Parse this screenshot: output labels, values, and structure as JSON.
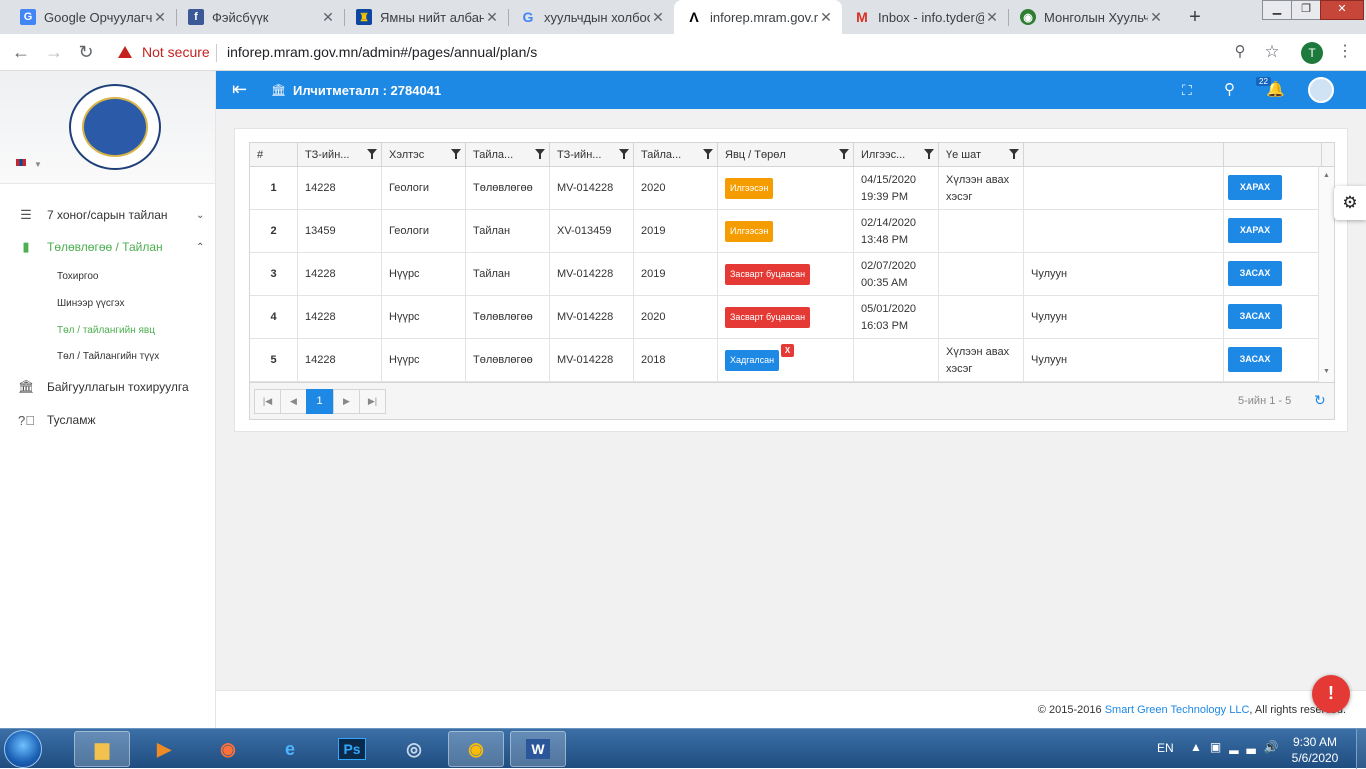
{
  "browser": {
    "tabs": [
      {
        "title": "Google Орчуулагч",
        "icon": "google-translate-icon",
        "icon_color": "#4285f4"
      },
      {
        "title": "Фэйсбүүк",
        "icon": "facebook-icon",
        "icon_color": "#3b5998"
      },
      {
        "title": "Ямны нийт албан",
        "icon": "soyombo-icon",
        "icon_color": "#c4272f"
      },
      {
        "title": "хуульчдын холбоо",
        "icon": "google-icon",
        "icon_color": "#4285f4"
      },
      {
        "title": "inforep.mram.gov.m",
        "icon": "site-a-icon",
        "icon_color": "#000000"
      },
      {
        "title": "Inbox - info.tyder@",
        "icon": "gmail-icon",
        "icon_color": "#d93025"
      },
      {
        "title": "Монголын Хуульч",
        "icon": "site-globe-icon",
        "icon_color": "#2e7d32"
      }
    ],
    "security_label": "Not secure",
    "url": "inforep.mram.gov.mn/admin#/pages/annual/plan/s",
    "profile_initial": "T"
  },
  "sidebar": {
    "menu": [
      {
        "label": "7 хоног/сарын тайлан",
        "icon": "list-icon"
      },
      {
        "label": "Төлөвлөгөө / Тайлан",
        "icon": "chart-icon"
      },
      {
        "label": "Байгууллагын тохируулга",
        "icon": "bank-icon"
      },
      {
        "label": "Тусламж",
        "icon": "help-icon"
      }
    ],
    "submenu": [
      {
        "label": "Тохиргоо"
      },
      {
        "label": "Шинээр үүсгэх"
      },
      {
        "label": "Төл / тайлангийн явц"
      },
      {
        "label": "Төл / Тайлангийн түүх"
      }
    ]
  },
  "header": {
    "company": "Илчитметалл : 2784041",
    "notification_count": "22"
  },
  "grid": {
    "columns": [
      "#",
      "ТЗ-ийн...",
      "Хэлтэс",
      "Тайла...",
      "ТЗ-ийн...",
      "Тайла...",
      "Явц / Төрөл",
      "Илгээс...",
      "Үе шат",
      "",
      ""
    ],
    "rows": [
      {
        "n": "1",
        "tz": "14228",
        "dept": "Геологи",
        "type": "Төлөвлөгөө",
        "code": "MV-014228",
        "year": "2020",
        "status": "Илгээсэн",
        "status_color": "#f59d00",
        "date": "04/15/2020",
        "time": "19:39 PM",
        "stage": "Хүлээн авах хэсэг",
        "extra": "",
        "action": "ХАРАХ"
      },
      {
        "n": "2",
        "tz": "13459",
        "dept": "Геологи",
        "type": "Тайлан",
        "code": "XV-013459",
        "year": "2019",
        "status": "Илгээсэн",
        "status_color": "#f59d00",
        "date": "02/14/2020",
        "time": "13:48 PM",
        "stage": "",
        "extra": "",
        "action": "ХАРАХ"
      },
      {
        "n": "3",
        "tz": "14228",
        "dept": "Нүүрс",
        "type": "Тайлан",
        "code": "MV-014228",
        "year": "2019",
        "status": "Засварт буцаасан",
        "status_color": "#e53935",
        "date": "02/07/2020",
        "time": "00:35 AM",
        "stage": "",
        "extra": "Чулуун",
        "action": "ЗАСАХ"
      },
      {
        "n": "4",
        "tz": "14228",
        "dept": "Нүүрс",
        "type": "Төлөвлөгөө",
        "code": "MV-014228",
        "year": "2020",
        "status": "Засварт буцаасан",
        "status_color": "#e53935",
        "date": "05/01/2020",
        "time": "16:03 PM",
        "stage": "",
        "extra": "Чулуун",
        "action": "ЗАСАХ"
      },
      {
        "n": "5",
        "tz": "14228",
        "dept": "Нүүрс",
        "type": "Төлөвлөгөө",
        "code": "MV-014228",
        "year": "2018",
        "status": "Хадгалсан",
        "status_color": "#1e88e5",
        "date": "",
        "time": "",
        "stage": "Хүлээн авах хэсэг",
        "extra": "Чулуун",
        "action": "ЗАСАХ",
        "delete_label": "X"
      }
    ],
    "pager": {
      "current_page": "1",
      "info": "5-ийн 1 - 5"
    }
  },
  "footer": {
    "prefix": "© 2015-2016 ",
    "company_link": "Smart Green Technology LLC",
    "suffix": ", All rights reserved."
  },
  "taskbar": {
    "apps": [
      "file-explorer-icon",
      "media-player-icon",
      "firefox-icon",
      "internet-explorer-icon",
      "photoshop-icon",
      "chrome-canary-icon",
      "chrome-icon",
      "word-icon"
    ],
    "language": "EN",
    "time": "9:30 AM",
    "date": "5/6/2020"
  },
  "colors": {
    "accent": "#1e88e5",
    "active_menu": "#4caf50"
  }
}
